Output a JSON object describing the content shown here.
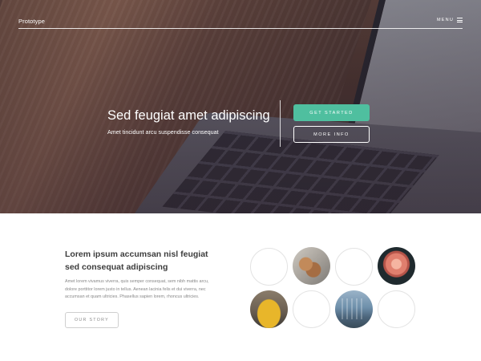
{
  "header": {
    "logo": "Prototype",
    "menu_label": "MENU"
  },
  "hero": {
    "title": "Sed feugiat amet adipiscing",
    "subtitle": "Amet tincidunt arcu suspendisse consequat",
    "primary_button": "GET STARTED",
    "secondary_button": "MORE INFO"
  },
  "about": {
    "title_lines": [
      "Lorem ipsum accumsan nisl feugiat",
      "sed consequat adipiscing"
    ],
    "body_lines": [
      "Amet lorem vivamus viverra, quis semper consequat, sem nibh mattis arcu,",
      "dolore porttitor lorem justo in tellus. Aenean lacinia felis et dui viverra, nec",
      "accumsan et quam ultricies. Phasellus sapien lorem, rhoncus ultricies."
    ],
    "button": "OUR STORY"
  },
  "gallery": {
    "items": [
      {
        "icon": "empty-circle"
      },
      {
        "icon": "shoes-photo"
      },
      {
        "icon": "empty-circle"
      },
      {
        "icon": "flower-photo"
      },
      {
        "icon": "taxi-photo"
      },
      {
        "icon": "empty-circle"
      },
      {
        "icon": "building-photo"
      },
      {
        "icon": "empty-circle"
      }
    ]
  },
  "colors": {
    "accent": "#4fbf9f",
    "text_dark": "#3d3d3d",
    "text_muted": "#888888"
  }
}
